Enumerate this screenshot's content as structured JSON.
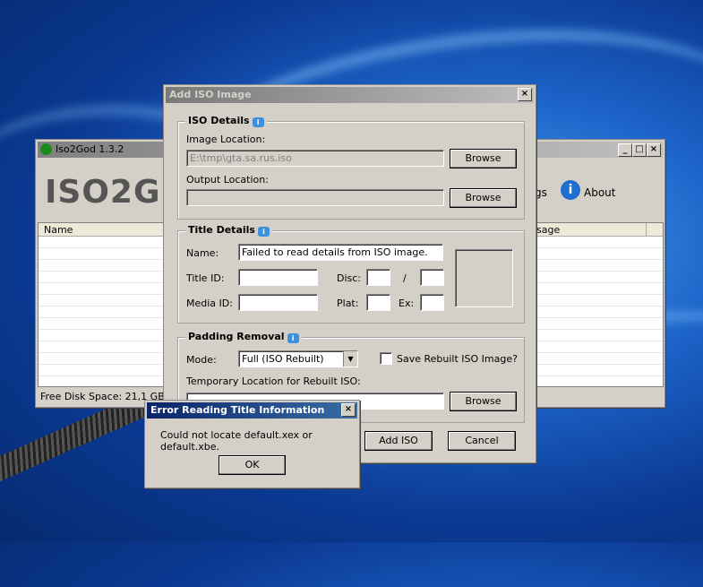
{
  "main_window": {
    "title": "Iso2God 1.3.2",
    "logo_text": "ISO2G",
    "settings_partial": "gs",
    "about_label": "About",
    "columns": [
      "Name",
      "sage"
    ],
    "status": "Free Disk Space: 21,1 GB"
  },
  "add_dialog": {
    "title": "Add ISO Image",
    "iso_details": {
      "heading": "ISO Details",
      "image_location_label": "Image Location:",
      "image_location_value": "E:\\tmp\\gta.sa.rus.iso",
      "output_location_label": "Output Location:",
      "output_location_value": "",
      "browse": "Browse"
    },
    "title_details": {
      "heading": "Title Details",
      "name_label": "Name:",
      "name_value": "Failed to read details from ISO image.",
      "title_id_label": "Title ID:",
      "disc_label": "Disc:",
      "disc_sep": "/",
      "media_id_label": "Media ID:",
      "plat_label": "Plat:",
      "ex_label": "Ex:"
    },
    "padding": {
      "heading": "Padding Removal",
      "mode_label": "Mode:",
      "mode_value": "Full (ISO Rebuilt)",
      "save_rebuilt_label": "Save Rebuilt ISO Image?",
      "temp_label": "Temporary Location for Rebuilt ISO:",
      "browse": "Browse"
    },
    "add_button": "Add ISO",
    "cancel_button": "Cancel"
  },
  "error_dialog": {
    "title": "Error Reading Title Information",
    "message": "Could not locate default.xex or default.xbe.",
    "ok": "OK"
  }
}
